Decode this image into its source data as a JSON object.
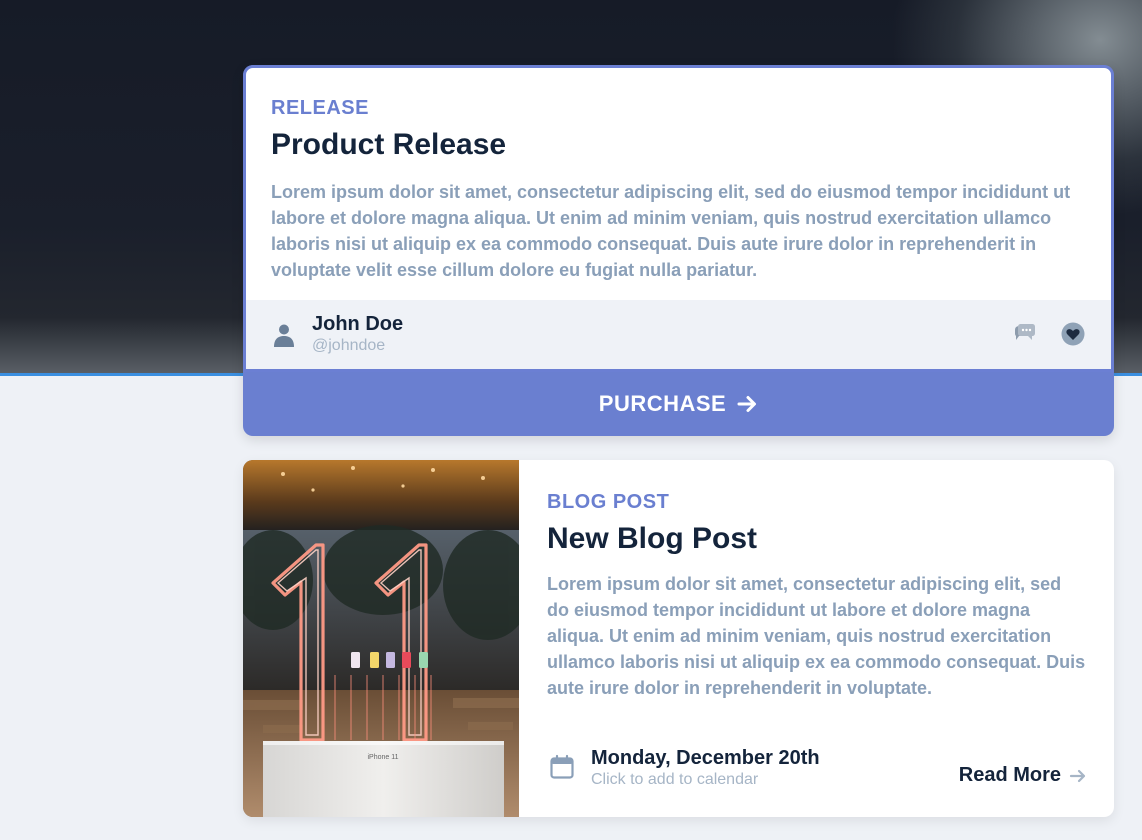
{
  "colors": {
    "accent": "#6a7fd0",
    "title": "#14243b",
    "body_text": "#8a9fb8",
    "muted": "#a6b5c6",
    "footer_bg": "#eff2f7",
    "hero_line": "#3b8fe0"
  },
  "release_card": {
    "eyebrow": "RELEASE",
    "title": "Product Release",
    "description": "Lorem ipsum dolor sit amet, consectetur adipiscing elit, sed do eiusmod tempor incididunt ut labore et dolore magna aliqua. Ut enim ad minim veniam, quis nostrud exercitation ullamco laboris nisi ut aliquip ex ea commodo consequat. Duis aute irure dolor in reprehenderit in voluptate velit esse cillum dolore eu fugiat nulla pariatur.",
    "author": {
      "name": "John Doe",
      "handle": "@johndoe",
      "icon": "user-icon"
    },
    "actions": [
      {
        "icon": "comment-icon"
      },
      {
        "icon": "heart-icon"
      }
    ],
    "button_label": "PURCHASE",
    "button_icon": "arrow-right-icon"
  },
  "blog_card": {
    "eyebrow": "BLOG POST",
    "title": "New Blog Post",
    "description": "Lorem ipsum dolor sit amet, consectetur adipiscing elit, sed do eiusmod tempor incididunt ut labore et dolore magna aliqua. Ut enim ad minim veniam, quis nostrud exercitation ullamco laboris nisi ut aliquip ex ea commodo consequat. Duis aute irure dolor in reprehenderit in voluptate.",
    "image_icon": "neon-eleven-photo",
    "image_caption": "iPhone 11",
    "event": {
      "date": "Monday, December 20th",
      "hint": "Click to add to calendar",
      "icon": "calendar-icon"
    },
    "read_more_label": "Read More",
    "read_more_icon": "arrow-right-icon"
  }
}
